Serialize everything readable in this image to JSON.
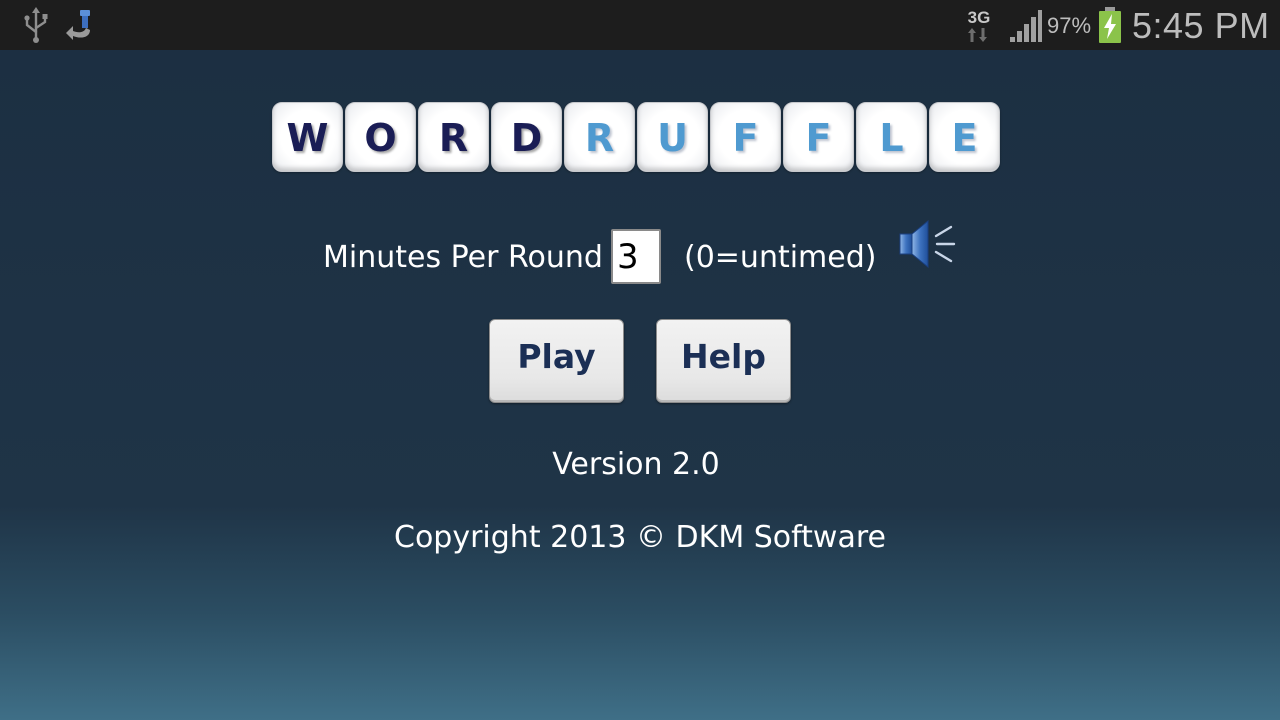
{
  "status_bar": {
    "left_icons": [
      "usb-icon",
      "download-icon"
    ],
    "network_type": "3G",
    "battery_percent": "97%",
    "battery_level": 0.97,
    "battery_charging": true,
    "time": "5:45 PM",
    "colors": {
      "background": "#1d1d1d",
      "text": "#bdbdbd",
      "battery": "#8bc34a"
    }
  },
  "logo": {
    "tiles": [
      {
        "letter": "W",
        "style": "dark"
      },
      {
        "letter": "O",
        "style": "dark"
      },
      {
        "letter": "R",
        "style": "dark"
      },
      {
        "letter": "D",
        "style": "dark"
      },
      {
        "letter": "R",
        "style": "light"
      },
      {
        "letter": "U",
        "style": "light"
      },
      {
        "letter": "F",
        "style": "light"
      },
      {
        "letter": "F",
        "style": "light"
      },
      {
        "letter": "L",
        "style": "light"
      },
      {
        "letter": "E",
        "style": "light"
      }
    ],
    "colors": {
      "dark_letter": "#1a1d55",
      "light_letter": "#4f9ad0"
    }
  },
  "settings": {
    "minutes_label": "Minutes Per Round",
    "minutes_value": "3",
    "untimed_label": "(0=untimed)",
    "sound_icon": "speaker-icon"
  },
  "buttons": {
    "play_label": "Play",
    "help_label": "Help"
  },
  "footer": {
    "version": "Version 2.0",
    "copyright": "Copyright 2013 © DKM Software"
  },
  "colors": {
    "background_top": "#1c2f42",
    "background_bottom": "#3f6f87",
    "button_text": "#1b2f55"
  }
}
